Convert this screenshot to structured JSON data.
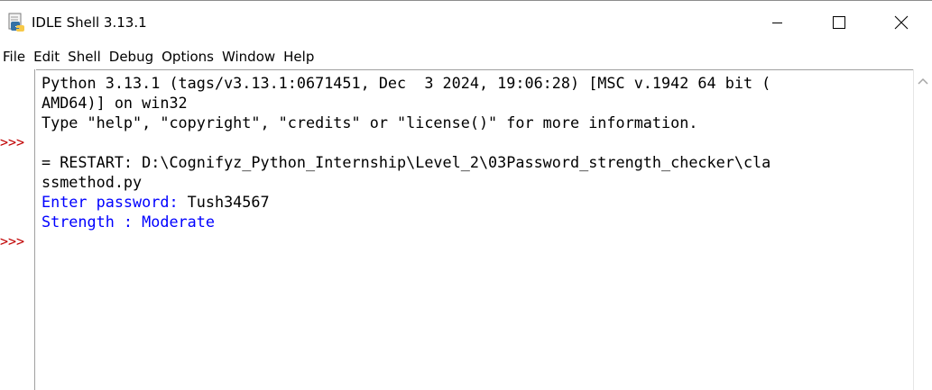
{
  "window": {
    "title": "IDLE Shell 3.13.1",
    "icon": "python-idle-icon",
    "controls": [
      "minimize-icon",
      "maximize-icon",
      "close-icon"
    ]
  },
  "menu": {
    "items": [
      "File",
      "Edit",
      "Shell",
      "Debug",
      "Options",
      "Window",
      "Help"
    ]
  },
  "shell": {
    "prompt": ">>>",
    "lines": [
      "Python 3.13.1 (tags/v3.13.1:0671451, Dec  3 2024, 19:06:28) [MSC v.1942 64 bit (",
      "AMD64)] on win32",
      "Type \"help\", \"copyright\", \"credits\" or \"license()\" for more information.",
      "",
      "= RESTART: D:\\Cognifyz_Python_Internship\\Level_2\\03Password_strength_checker\\cla",
      "ssmethod.py",
      "Enter password: ",
      "Strength : Moderate"
    ],
    "input_value": "Tush34567"
  },
  "colors": {
    "prompt": "#c00000",
    "stdout": "#0000ff",
    "text": "#000000"
  }
}
